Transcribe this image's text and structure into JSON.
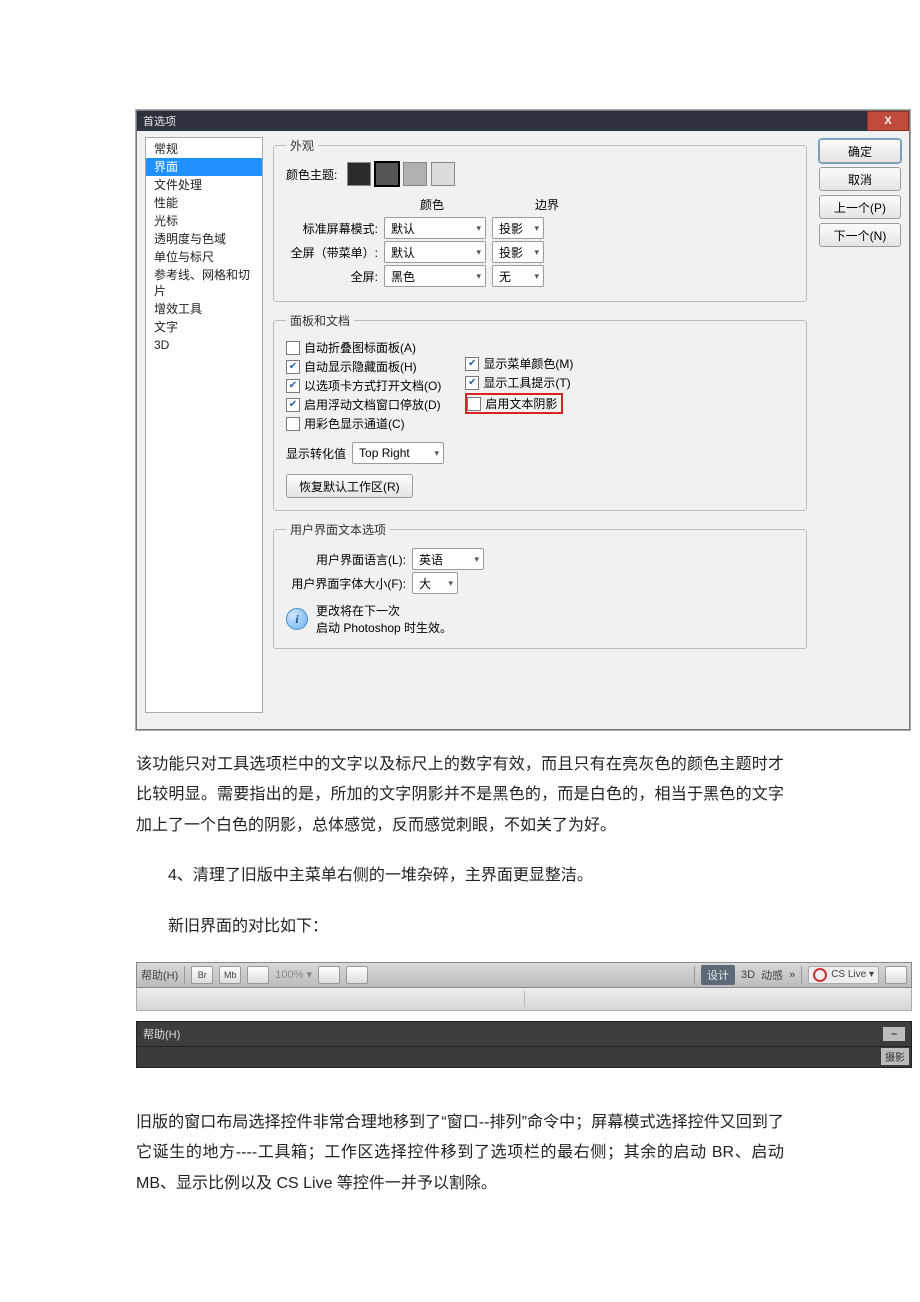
{
  "dialog": {
    "title": "首选项",
    "close_glyph": "X",
    "sidebar": [
      "常规",
      "界面",
      "文件处理",
      "性能",
      "光标",
      "透明度与色域",
      "单位与标尺",
      "参考线、网格和切片",
      "增效工具",
      "文字",
      "3D"
    ],
    "selected_index": 1,
    "buttons": {
      "ok": "确定",
      "cancel": "取消",
      "prev": "上一个(P)",
      "next": "下一个(N)"
    },
    "appearance": {
      "legend": "外观",
      "color_theme_label": "颜色主题:",
      "swatches": [
        "#2b2b2b",
        "#555555",
        "#b0b0b0",
        "#dcdcdc"
      ],
      "selected_swatch": 1,
      "col_color": "颜色",
      "col_border": "边界",
      "rows": [
        {
          "label": "标准屏幕模式:",
          "color": "默认",
          "border": "投影"
        },
        {
          "label": "全屏（带菜单）:",
          "color": "默认",
          "border": "投影"
        },
        {
          "label": "全屏:",
          "color": "黑色",
          "border": "无"
        }
      ]
    },
    "panels": {
      "legend": "面板和文档",
      "left": [
        {
          "checked": false,
          "text": "自动折叠图标面板(A)"
        },
        {
          "checked": true,
          "text": "自动显示隐藏面板(H)"
        },
        {
          "checked": true,
          "text": "以选项卡方式打开文档(O)"
        },
        {
          "checked": true,
          "text": "启用浮动文档窗口停放(D)"
        },
        {
          "checked": false,
          "text": "用彩色显示通道(C)"
        }
      ],
      "right": [
        {
          "checked": true,
          "text": "显示菜单颜色(M)"
        },
        {
          "checked": true,
          "text": "显示工具提示(T)"
        },
        {
          "checked": false,
          "text": "启用文本阴影",
          "hl": true
        }
      ],
      "show_trans_label": "显示转化值",
      "show_trans_value": "Top Right",
      "restore": "恢复默认工作区(R)"
    },
    "uitext": {
      "legend": "用户界面文本选项",
      "lang_label": "用户界面语言(L):",
      "lang_value": "英语",
      "size_label": "用户界面字体大小(F):",
      "size_value": "大",
      "note1": "更改将在下一次",
      "note2": "启动 Photoshop 时生效。"
    }
  },
  "para1": "该功能只对工具选项栏中的文字以及标尺上的数字有效，而且只有在亮灰色的颜色主题时才比较明显。需要指出的是，所加的文字阴影并不是黑色的，而是白色的，相当于黑色的文字加上了一个白色的阴影，总体感觉，反而感觉刺眼，不如关了为好。",
  "para2": "4、清理了旧版中主菜单右侧的一堆杂碎，主界面更显整洁。",
  "para3": "新旧界面的对比如下：",
  "para4": "旧版的窗口布局选择控件非常合理地移到了“窗口--排列”命令中；屏幕模式选择控件又回到了它诞生的地方----工具箱；工作区选择控件移到了选项栏的最右侧；其余的启动 BR、启动 MB、显示比例以及 CS Live 等控件一并予以割除。",
  "tb1": {
    "help": "帮助(H)",
    "br": "Br",
    "mb": "Mb",
    "zoom": "100% ▾",
    "tab_design": "设计",
    "tab_3d": "3D",
    "tab_motion": "动感",
    "more": "»",
    "cslive": "CS Live ▾"
  },
  "tb2": {
    "help": "帮助(H)",
    "minus": "–",
    "photo": "摄影"
  }
}
